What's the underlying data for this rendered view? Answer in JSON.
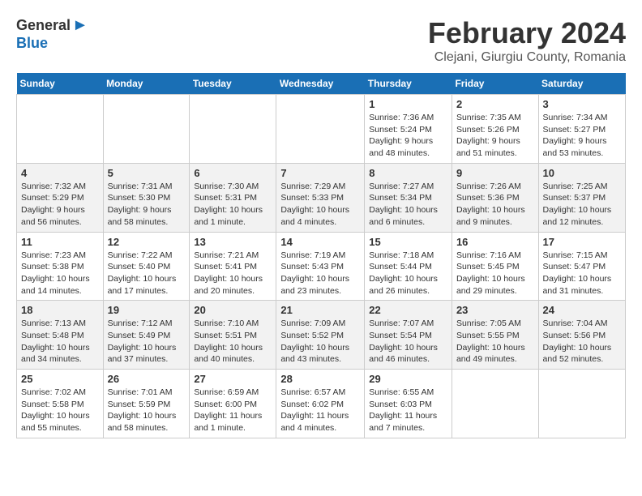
{
  "header": {
    "month_year": "February 2024",
    "location": "Clejani, Giurgiu County, Romania"
  },
  "logo": {
    "line1": "General",
    "line2": "Blue"
  },
  "days_of_week": [
    "Sunday",
    "Monday",
    "Tuesday",
    "Wednesday",
    "Thursday",
    "Friday",
    "Saturday"
  ],
  "weeks": [
    [
      {
        "day": "",
        "info": ""
      },
      {
        "day": "",
        "info": ""
      },
      {
        "day": "",
        "info": ""
      },
      {
        "day": "",
        "info": ""
      },
      {
        "day": "1",
        "info": "Sunrise: 7:36 AM\nSunset: 5:24 PM\nDaylight: 9 hours and 48 minutes."
      },
      {
        "day": "2",
        "info": "Sunrise: 7:35 AM\nSunset: 5:26 PM\nDaylight: 9 hours and 51 minutes."
      },
      {
        "day": "3",
        "info": "Sunrise: 7:34 AM\nSunset: 5:27 PM\nDaylight: 9 hours and 53 minutes."
      }
    ],
    [
      {
        "day": "4",
        "info": "Sunrise: 7:32 AM\nSunset: 5:29 PM\nDaylight: 9 hours and 56 minutes."
      },
      {
        "day": "5",
        "info": "Sunrise: 7:31 AM\nSunset: 5:30 PM\nDaylight: 9 hours and 58 minutes."
      },
      {
        "day": "6",
        "info": "Sunrise: 7:30 AM\nSunset: 5:31 PM\nDaylight: 10 hours and 1 minute."
      },
      {
        "day": "7",
        "info": "Sunrise: 7:29 AM\nSunset: 5:33 PM\nDaylight: 10 hours and 4 minutes."
      },
      {
        "day": "8",
        "info": "Sunrise: 7:27 AM\nSunset: 5:34 PM\nDaylight: 10 hours and 6 minutes."
      },
      {
        "day": "9",
        "info": "Sunrise: 7:26 AM\nSunset: 5:36 PM\nDaylight: 10 hours and 9 minutes."
      },
      {
        "day": "10",
        "info": "Sunrise: 7:25 AM\nSunset: 5:37 PM\nDaylight: 10 hours and 12 minutes."
      }
    ],
    [
      {
        "day": "11",
        "info": "Sunrise: 7:23 AM\nSunset: 5:38 PM\nDaylight: 10 hours and 14 minutes."
      },
      {
        "day": "12",
        "info": "Sunrise: 7:22 AM\nSunset: 5:40 PM\nDaylight: 10 hours and 17 minutes."
      },
      {
        "day": "13",
        "info": "Sunrise: 7:21 AM\nSunset: 5:41 PM\nDaylight: 10 hours and 20 minutes."
      },
      {
        "day": "14",
        "info": "Sunrise: 7:19 AM\nSunset: 5:43 PM\nDaylight: 10 hours and 23 minutes."
      },
      {
        "day": "15",
        "info": "Sunrise: 7:18 AM\nSunset: 5:44 PM\nDaylight: 10 hours and 26 minutes."
      },
      {
        "day": "16",
        "info": "Sunrise: 7:16 AM\nSunset: 5:45 PM\nDaylight: 10 hours and 29 minutes."
      },
      {
        "day": "17",
        "info": "Sunrise: 7:15 AM\nSunset: 5:47 PM\nDaylight: 10 hours and 31 minutes."
      }
    ],
    [
      {
        "day": "18",
        "info": "Sunrise: 7:13 AM\nSunset: 5:48 PM\nDaylight: 10 hours and 34 minutes."
      },
      {
        "day": "19",
        "info": "Sunrise: 7:12 AM\nSunset: 5:49 PM\nDaylight: 10 hours and 37 minutes."
      },
      {
        "day": "20",
        "info": "Sunrise: 7:10 AM\nSunset: 5:51 PM\nDaylight: 10 hours and 40 minutes."
      },
      {
        "day": "21",
        "info": "Sunrise: 7:09 AM\nSunset: 5:52 PM\nDaylight: 10 hours and 43 minutes."
      },
      {
        "day": "22",
        "info": "Sunrise: 7:07 AM\nSunset: 5:54 PM\nDaylight: 10 hours and 46 minutes."
      },
      {
        "day": "23",
        "info": "Sunrise: 7:05 AM\nSunset: 5:55 PM\nDaylight: 10 hours and 49 minutes."
      },
      {
        "day": "24",
        "info": "Sunrise: 7:04 AM\nSunset: 5:56 PM\nDaylight: 10 hours and 52 minutes."
      }
    ],
    [
      {
        "day": "25",
        "info": "Sunrise: 7:02 AM\nSunset: 5:58 PM\nDaylight: 10 hours and 55 minutes."
      },
      {
        "day": "26",
        "info": "Sunrise: 7:01 AM\nSunset: 5:59 PM\nDaylight: 10 hours and 58 minutes."
      },
      {
        "day": "27",
        "info": "Sunrise: 6:59 AM\nSunset: 6:00 PM\nDaylight: 11 hours and 1 minute."
      },
      {
        "day": "28",
        "info": "Sunrise: 6:57 AM\nSunset: 6:02 PM\nDaylight: 11 hours and 4 minutes."
      },
      {
        "day": "29",
        "info": "Sunrise: 6:55 AM\nSunset: 6:03 PM\nDaylight: 11 hours and 7 minutes."
      },
      {
        "day": "",
        "info": ""
      },
      {
        "day": "",
        "info": ""
      }
    ]
  ]
}
